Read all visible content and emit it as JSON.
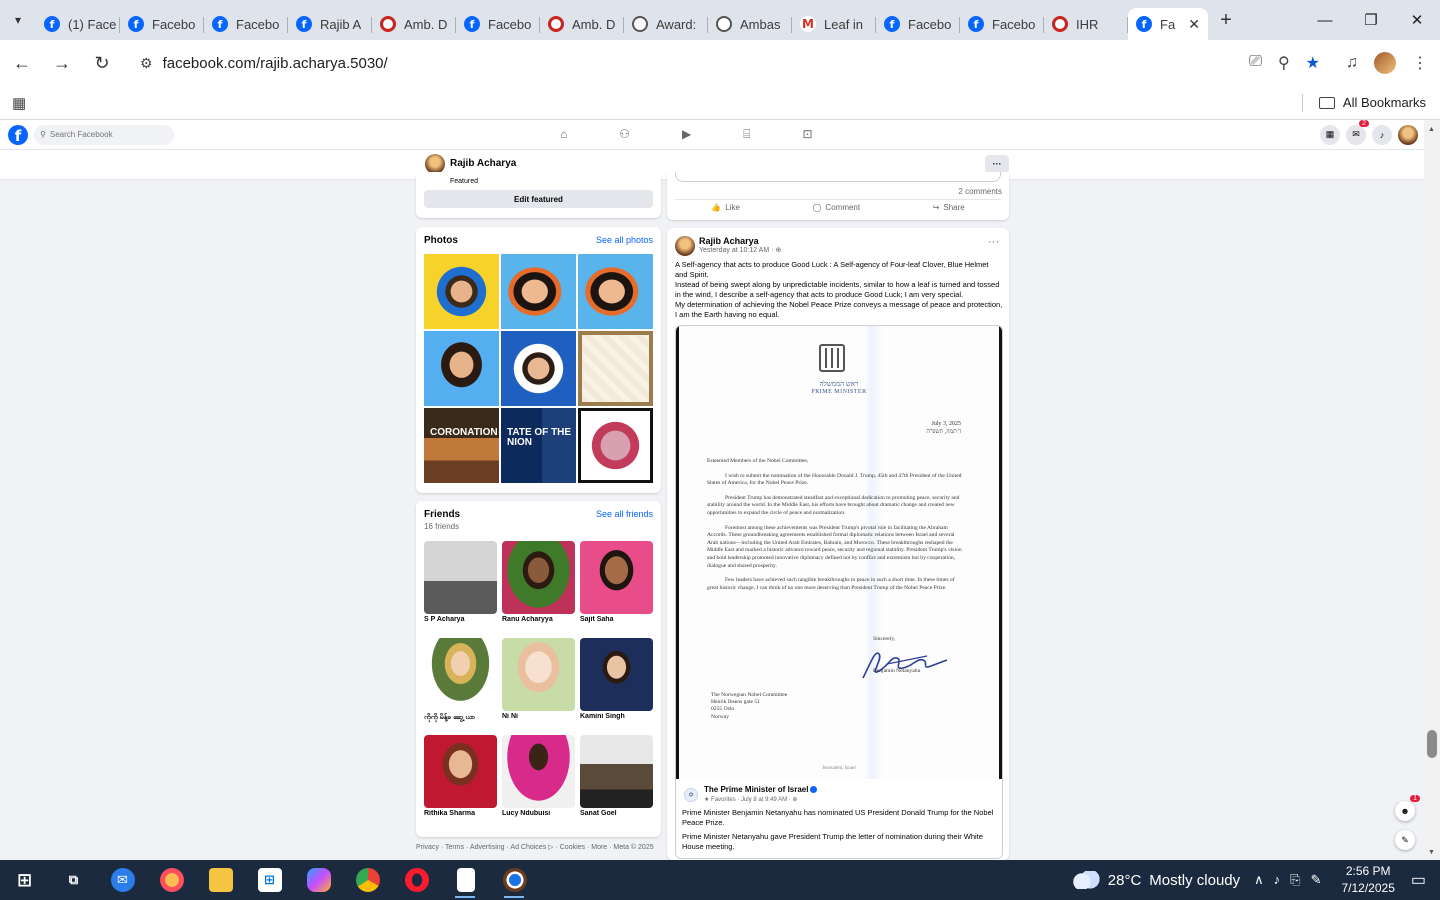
{
  "browser": {
    "tabs": [
      {
        "label": "(1) Face",
        "icon": "facebook"
      },
      {
        "label": "Facebo",
        "icon": "facebook"
      },
      {
        "label": "Facebo",
        "icon": "facebook"
      },
      {
        "label": "Rajib A",
        "icon": "facebook"
      },
      {
        "label": "Amb. D",
        "icon": "red-circle"
      },
      {
        "label": "Facebo",
        "icon": "facebook"
      },
      {
        "label": "Amb. D",
        "icon": "red-circle"
      },
      {
        "label": "Award:",
        "icon": "globe"
      },
      {
        "label": "Ambas",
        "icon": "globe"
      },
      {
        "label": "Leaf in",
        "icon": "gmail"
      },
      {
        "label": "Facebo",
        "icon": "facebook"
      },
      {
        "label": "Facebo",
        "icon": "facebook"
      },
      {
        "label": "IHR",
        "icon": "red-circle"
      },
      {
        "label": "Fa",
        "icon": "facebook",
        "active": true
      }
    ],
    "url": "facebook.com/rajib.acharya.5030/",
    "bookmarks_label": "All Bookmarks"
  },
  "fb_nav": {
    "search_placeholder": "Search Facebook",
    "notification_count": "2"
  },
  "profile_header": {
    "name": "Rajib Acharya",
    "more_label": "···"
  },
  "featured": {
    "label": "Featured",
    "edit_button": "Edit featured"
  },
  "photos": {
    "title": "Photos",
    "see_all": "See all photos",
    "items": [
      {
        "style": "ph-alert",
        "text": ""
      },
      {
        "style": "ph-face2",
        "text": ""
      },
      {
        "style": "ph-face2",
        "text": ""
      },
      {
        "style": "ph-face",
        "text": ""
      },
      {
        "style": "ph-vax",
        "text": ""
      },
      {
        "style": "ph-card",
        "text": ""
      },
      {
        "style": "ph-coro",
        "text": "CORONATION"
      },
      {
        "style": "ph-sotu",
        "text": "TATE OF THE NION"
      },
      {
        "style": "ph-king",
        "text": ""
      }
    ]
  },
  "friends": {
    "title": "Friends",
    "count": "16 friends",
    "see_all": "See all friends",
    "items": [
      {
        "name": "S P Acharya",
        "style": "fp1"
      },
      {
        "name": "Ranu Acharyya",
        "style": "fp2"
      },
      {
        "name": "Sajit Saha",
        "style": "fp3"
      },
      {
        "name": "ကိုကို မိန့်ခ ဆွေ့ ယာ",
        "style": "fp4"
      },
      {
        "name": "Ni Ni",
        "style": "fp5"
      },
      {
        "name": "Kamini Singh",
        "style": "fp6"
      },
      {
        "name": "Rithika Sharma",
        "style": "fp7"
      },
      {
        "name": "Lucy Ndubuisi",
        "style": "fp8"
      },
      {
        "name": "Sanat Goel",
        "style": "fp9"
      }
    ]
  },
  "footer": "Privacy · Terms · Advertising · Ad Choices ▷ · Cookies · More · Meta © 2025",
  "prev_post": {
    "comments": "2 comments",
    "like": "Like",
    "comment": "Comment",
    "share": "Share"
  },
  "post": {
    "author": "Rajib Acharya",
    "time": "Yesterday at 10:12 AM · ⊕",
    "more": "···",
    "text": [
      "A Self-agency  that acts to produce Good Luck : A Self-agency  of Four-leaf Clover, Blue Helmet and Spirit.",
      "Instead of being swept along by unpredictable incidents, similar to how a leaf is turned and tossed in the wind, I describe a self-agency that acts to produce Good Luck; I am very special.",
      "My determination of achieving the Nobel Peace Prize conveys a message of peace and protection, I am the Earth having no equal."
    ],
    "letter": {
      "hebrew": "ראש הממשלה",
      "title": "PRIME MINISTER",
      "date_line1": "July 3, 2025",
      "date_line2": "ז' תמוז, תשפ\"ה",
      "paragraphs": [
        "Esteemed Members of the Nobel Committee,",
        "I wish to submit the nomination of the Honorable Donald J. Trump, 45th and 47th President of the United States of America, for the Nobel Peace Prize.",
        "President Trump has demonstrated steadfast and exceptional dedication to promoting peace, security and stability around the world. In the Middle East, his efforts have brought about dramatic change and created new opportunities to expand the circle of peace and normalization.",
        "Foremost among these achievements was President Trump's pivotal role in facilitating the Abraham Accords. These groundbreaking agreements established formal diplomatic relations between Israel and several Arab nations—including the United Arab Emirates, Bahrain, and Morocco. These breakthroughs reshaped the Middle East and marked a historic advance toward peace, security and regional stability. President Trump's vision and bold leadership promoted innovative diplomacy defined not by conflict and extremism but by cooperation, dialogue and shared prosperity.",
        "Few leaders have achieved such tangible breakthroughs to peace in such a short time. In these times of great historic change, I can think of no one more deserving than President Trump of the Nobel Peace Prize."
      ],
      "sincerely": "Sincerely,",
      "signer": "Benjamin Netanyahu",
      "address": [
        "The Norwegian Nobel Committee",
        "Henrik Ibsens gate 51",
        "0255 Oslo",
        "Norway"
      ],
      "footer": "Jerusalem, Israel"
    },
    "shared": {
      "page_name": "The Prime Minister of Israel",
      "sub": "★ Favorites · July 8 at 9:49 AM · ⊕",
      "text1": "Prime Minister Benjamin Netanyahu has nominated US President Donald Trump for the Nobel Peace Prize.",
      "text2": "Prime Minister Netanyahu gave President Trump the letter of nomination during their White House meeting."
    }
  },
  "floating": {
    "badge": "1"
  },
  "taskbar": {
    "temperature": "28°C",
    "weather": "Mostly cloudy",
    "time": "2:56 PM",
    "date": "7/12/2025"
  }
}
